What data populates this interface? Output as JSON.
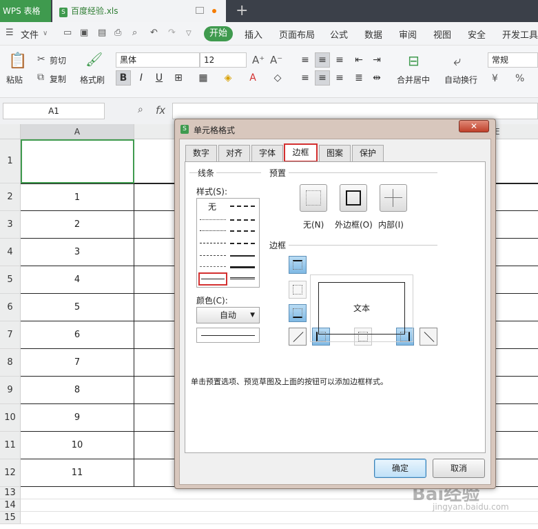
{
  "titlebar": {
    "app_tab": "WPS 表格",
    "doc_tab": "百度经验.xls",
    "doc_icon": "S",
    "new_tab": "+"
  },
  "menubar": {
    "file": "文件",
    "items": [
      "开始",
      "插入",
      "页面布局",
      "公式",
      "数据",
      "审阅",
      "视图",
      "安全",
      "开发工具"
    ]
  },
  "ribbon": {
    "paste": "粘贴",
    "cut": "剪切",
    "copy": "复制",
    "format_painter": "格式刷",
    "font_name": "黑体",
    "font_size": "12",
    "merge_center": "合并居中",
    "wrap_text": "自动换行",
    "number_format": "常规",
    "increase_font_icon": "A⁺",
    "decrease_font_icon": "A⁻"
  },
  "formula_bar": {
    "name_box": "A1",
    "fx": "fx"
  },
  "grid": {
    "columns": [
      "A",
      "E"
    ],
    "rows": [
      {
        "num": "1",
        "a": ""
      },
      {
        "num": "2",
        "a": "1"
      },
      {
        "num": "3",
        "a": "2"
      },
      {
        "num": "4",
        "a": "3"
      },
      {
        "num": "5",
        "a": "4"
      },
      {
        "num": "6",
        "a": "5"
      },
      {
        "num": "7",
        "a": "6"
      },
      {
        "num": "8",
        "a": "7"
      },
      {
        "num": "9",
        "a": "8"
      },
      {
        "num": "10",
        "a": "9"
      },
      {
        "num": "11",
        "a": "10"
      },
      {
        "num": "12",
        "a": "11"
      },
      {
        "num": "13",
        "a": ""
      },
      {
        "num": "14",
        "a": ""
      },
      {
        "num": "15",
        "a": ""
      }
    ]
  },
  "dialog": {
    "title": "单元格格式",
    "tabs": [
      "数字",
      "对齐",
      "字体",
      "边框",
      "图案",
      "保护"
    ],
    "active_tab": "边框",
    "line_group": "线条",
    "style_label": "样式(S):",
    "style_none": "无",
    "color_label": "颜色(C):",
    "color_value": "自动",
    "preset_group": "预置",
    "presets": [
      "无(N)",
      "外边框(O)",
      "内部(I)"
    ],
    "border_group": "边框",
    "preview_text": "文本",
    "hint": "单击预置选项、预览草图及上面的按钮可以添加边框样式。",
    "ok": "确定",
    "cancel": "取消",
    "close": "✕"
  },
  "watermark": {
    "main": "Bai经验",
    "sub": "jingyan.baidu.com"
  },
  "colors": {
    "brand_green": "#3f9a4e",
    "highlight_red": "#d32f2f",
    "dialog_frame": "#d8c7bd"
  }
}
